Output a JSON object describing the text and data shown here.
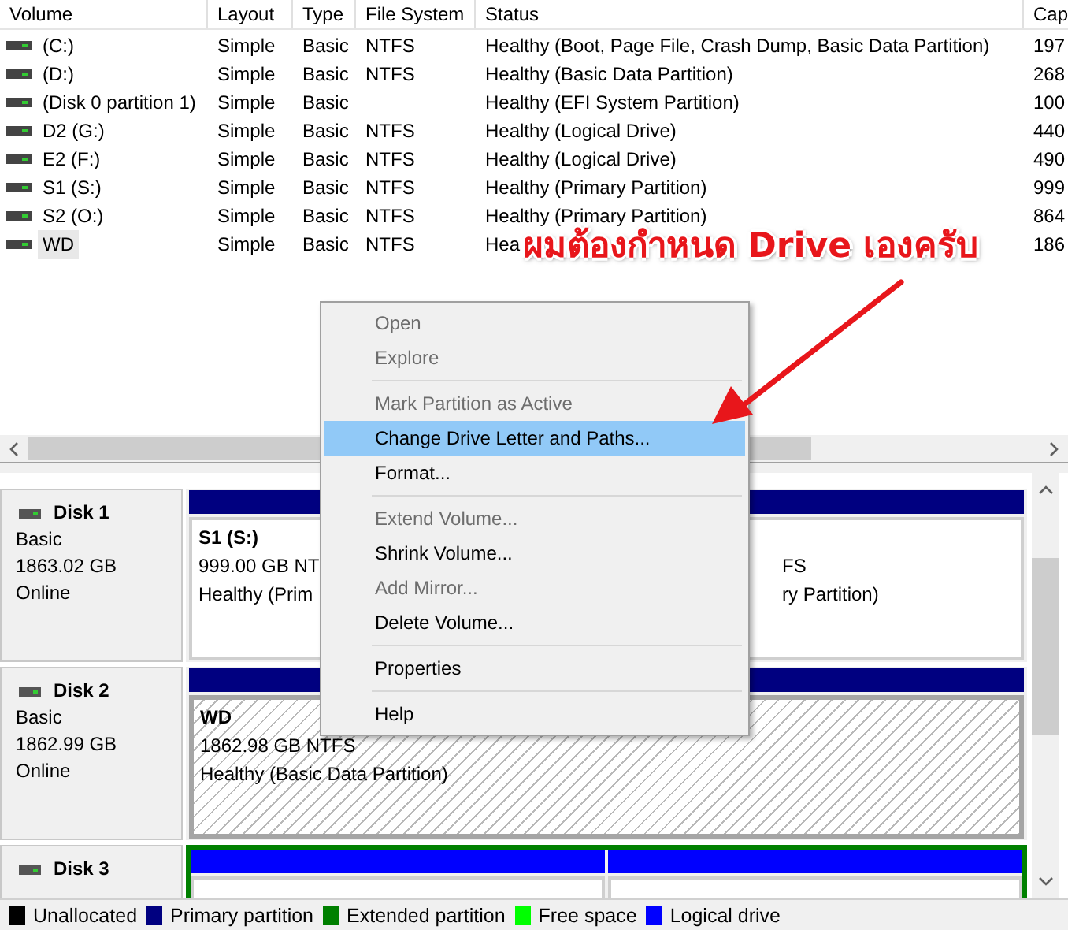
{
  "volume_list": {
    "columns": [
      "Volume",
      "Layout",
      "Type",
      "File System",
      "Status",
      "Cap"
    ],
    "rows": [
      {
        "cells": [
          "(C:)",
          "Simple",
          "Basic",
          "NTFS",
          "Healthy (Boot, Page File, Crash Dump, Basic Data Partition)",
          "197"
        ],
        "selected": false
      },
      {
        "cells": [
          "(D:)",
          "Simple",
          "Basic",
          "NTFS",
          "Healthy (Basic Data Partition)",
          "268"
        ],
        "selected": false
      },
      {
        "cells": [
          "(Disk 0 partition 1)",
          "Simple",
          "Basic",
          "",
          "Healthy (EFI System Partition)",
          "100"
        ],
        "selected": false
      },
      {
        "cells": [
          "D2 (G:)",
          "Simple",
          "Basic",
          "NTFS",
          "Healthy (Logical Drive)",
          "440"
        ],
        "selected": false
      },
      {
        "cells": [
          "E2 (F:)",
          "Simple",
          "Basic",
          "NTFS",
          "Healthy (Logical Drive)",
          "490"
        ],
        "selected": false
      },
      {
        "cells": [
          "S1 (S:)",
          "Simple",
          "Basic",
          "NTFS",
          "Healthy (Primary Partition)",
          "999"
        ],
        "selected": false
      },
      {
        "cells": [
          "S2 (O:)",
          "Simple",
          "Basic",
          "NTFS",
          "Healthy (Primary Partition)",
          "864"
        ],
        "selected": false
      },
      {
        "cells": [
          "WD",
          "Simple",
          "Basic",
          "NTFS",
          "Hea",
          "186"
        ],
        "selected": true
      }
    ]
  },
  "disks": [
    {
      "name": "Disk 1",
      "type": "Basic",
      "size": "1863.02 GB",
      "status": "Online",
      "extended": false,
      "partitions": [
        {
          "name": "S1  (S:)",
          "size": "999.00 GB NT",
          "status": "Healthy (Prim",
          "kind": "primary",
          "selected": false
        },
        {
          "size": "FS",
          "status": "ry Partition)",
          "kind": "primary",
          "selected": false
        }
      ]
    },
    {
      "name": "Disk 2",
      "type": "Basic",
      "size": "1862.99 GB",
      "status": "Online",
      "extended": false,
      "partitions": [
        {
          "name": "WD",
          "size": "1862.98 GB NTFS",
          "status": "Healthy (Basic Data Partition)",
          "kind": "primary",
          "selected": true
        }
      ]
    },
    {
      "name": "Disk 3",
      "extended": true,
      "partitions": [
        {
          "kind": "logical",
          "selected": false
        },
        {
          "kind": "logical",
          "selected": false
        }
      ]
    }
  ],
  "context_menu": {
    "groups": [
      [
        {
          "label": "Open",
          "disabled": true,
          "selected": false
        },
        {
          "label": "Explore",
          "disabled": true,
          "selected": false
        }
      ],
      [
        {
          "label": "Mark Partition as Active",
          "disabled": true,
          "selected": false
        },
        {
          "label": "Change Drive Letter and Paths...",
          "disabled": false,
          "selected": true
        },
        {
          "label": "Format...",
          "disabled": false,
          "selected": false
        }
      ],
      [
        {
          "label": "Extend Volume...",
          "disabled": true,
          "selected": false
        },
        {
          "label": "Shrink Volume...",
          "disabled": false,
          "selected": false
        },
        {
          "label": "Add Mirror...",
          "disabled": true,
          "selected": false
        },
        {
          "label": "Delete Volume...",
          "disabled": false,
          "selected": false
        }
      ],
      [
        {
          "label": "Properties",
          "disabled": false,
          "selected": false
        }
      ],
      [
        {
          "label": "Help",
          "disabled": false,
          "selected": false
        }
      ]
    ]
  },
  "annotation": {
    "text": "ผมต้องกำหนด Drive เองครับ"
  },
  "legend": [
    {
      "label": "Unallocated",
      "color": "#000000"
    },
    {
      "label": "Primary partition",
      "color": "#000080"
    },
    {
      "label": "Extended partition",
      "color": "#008000"
    },
    {
      "label": "Free space",
      "color": "#00ff00"
    },
    {
      "label": "Logical drive",
      "color": "#0000ff"
    }
  ]
}
